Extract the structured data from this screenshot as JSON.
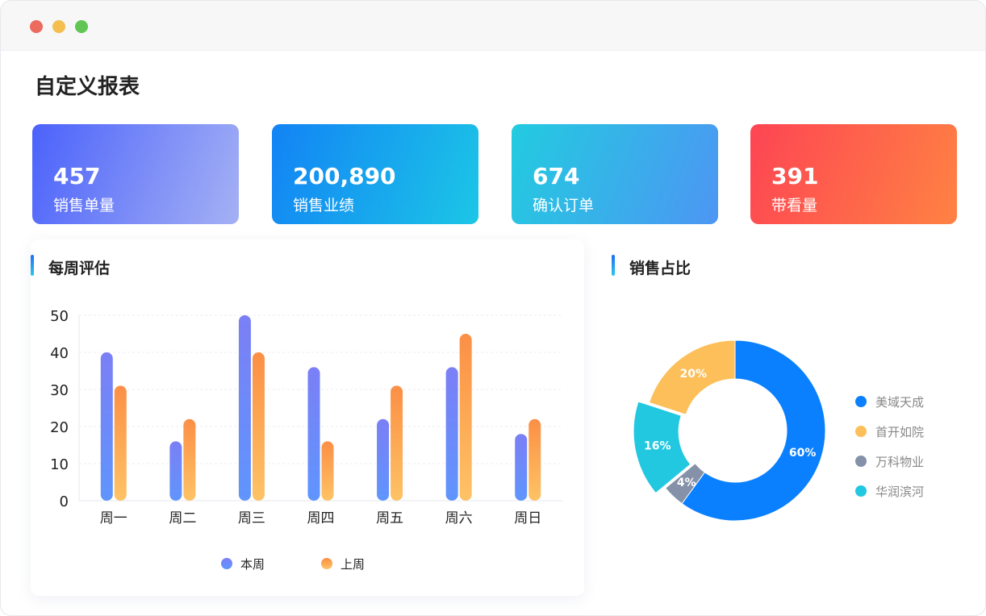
{
  "page": {
    "title": "自定义报表"
  },
  "stats": [
    {
      "value": "457",
      "label": "销售单量"
    },
    {
      "value": "200,890",
      "label": "销售业绩"
    },
    {
      "value": "674",
      "label": "确认订单"
    },
    {
      "value": "391",
      "label": "带看量"
    }
  ],
  "sections": {
    "weekly": "每周评估",
    "share": "销售占比"
  },
  "chart_data": [
    {
      "type": "bar",
      "categories": [
        "周一",
        "周二",
        "周三",
        "周四",
        "周五",
        "周六",
        "周日"
      ],
      "series": [
        {
          "name": "本周",
          "values": [
            40,
            16,
            50,
            36,
            22,
            36,
            18
          ],
          "color_top": "#7b7ff5",
          "color_bottom": "#5f95fd"
        },
        {
          "name": "上周",
          "values": [
            31,
            22,
            40,
            16,
            31,
            45,
            22
          ],
          "color_top": "#fb8f45",
          "color_bottom": "#fec366"
        }
      ],
      "yticks": [
        "0",
        "10",
        "20",
        "30",
        "40",
        "50"
      ],
      "ylim": [
        0,
        50
      ],
      "grid": true,
      "legend_position": "bottom"
    },
    {
      "type": "pie",
      "variant": "donut",
      "series": [
        {
          "name": "美域天成",
          "value": 60,
          "label": "60%",
          "color": "#0a80ff"
        },
        {
          "name": "万科物业",
          "value": 4,
          "label": "4%",
          "color": "#8591a8"
        },
        {
          "name": "华润滨河",
          "value": 16,
          "label": "16%",
          "color": "#22c8e0"
        },
        {
          "name": "首开如院",
          "value": 20,
          "label": "20%",
          "color": "#fcbf59"
        }
      ],
      "legend_order": [
        "美域天成",
        "首开如院",
        "万科物业",
        "华润滨河"
      ],
      "legend_position": "right"
    }
  ]
}
